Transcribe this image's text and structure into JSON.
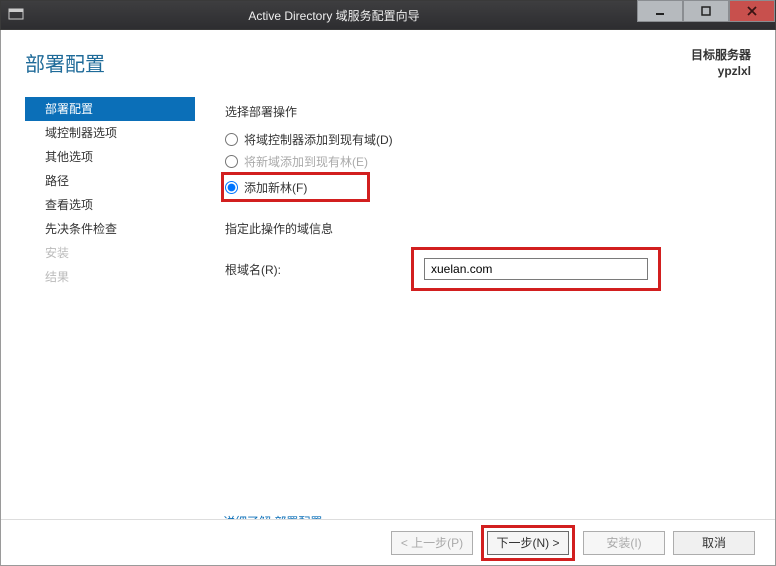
{
  "titlebar": {
    "title": "Active Directory 域服务配置向导"
  },
  "header": {
    "page_title": "部署配置",
    "target_label": "目标服务器",
    "target_name": "ypzlxl"
  },
  "sidebar": {
    "items": [
      {
        "label": "部署配置",
        "active": true,
        "disabled": false
      },
      {
        "label": "域控制器选项",
        "active": false,
        "disabled": false
      },
      {
        "label": "其他选项",
        "active": false,
        "disabled": false
      },
      {
        "label": "路径",
        "active": false,
        "disabled": false
      },
      {
        "label": "查看选项",
        "active": false,
        "disabled": false
      },
      {
        "label": "先决条件检查",
        "active": false,
        "disabled": false
      },
      {
        "label": "安装",
        "active": false,
        "disabled": true
      },
      {
        "label": "结果",
        "active": false,
        "disabled": true
      }
    ]
  },
  "panel": {
    "select_operation": "选择部署操作",
    "radio_add_dc": "将域控制器添加到现有域(D)",
    "radio_add_domain": "将新域添加到现有林(E)",
    "radio_new_forest": "添加新林(F)",
    "domain_info_label": "指定此操作的域信息",
    "root_domain_label": "根域名(R):",
    "root_domain_value": "xuelan.com",
    "more_link": "详细了解 部署配置"
  },
  "buttons": {
    "prev": "< 上一步(P)",
    "next": "下一步(N) >",
    "install": "安装(I)",
    "cancel": "取消"
  }
}
